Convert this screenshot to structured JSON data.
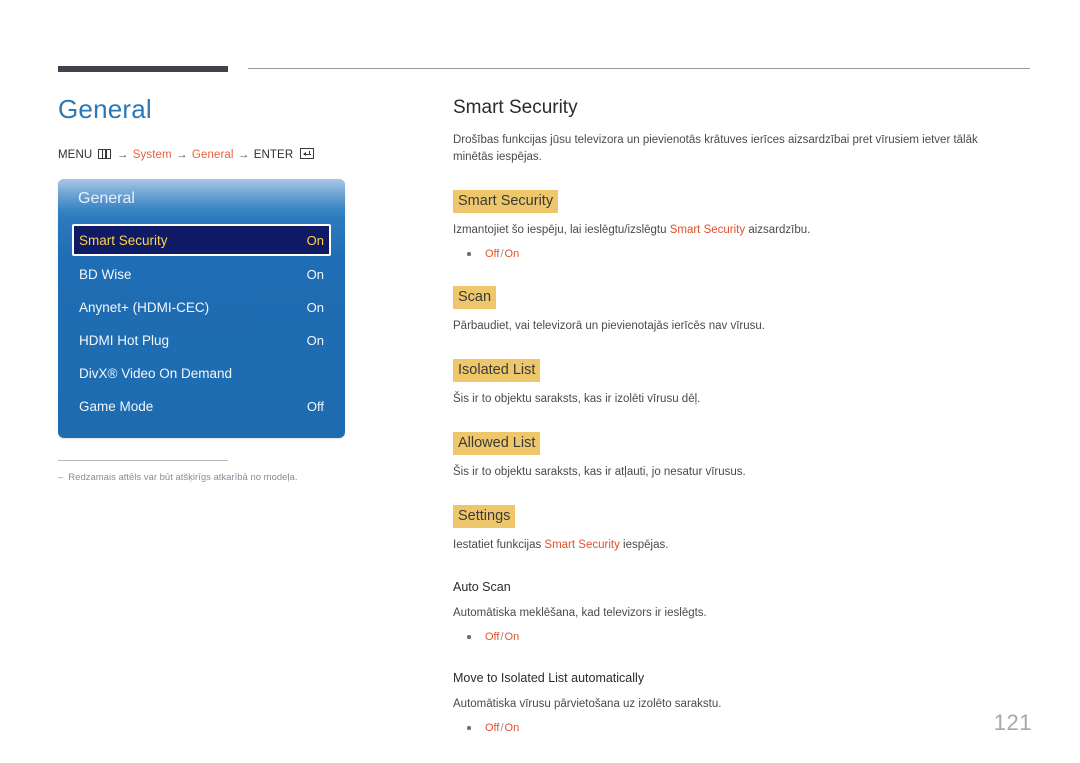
{
  "document": {
    "page_number": "121",
    "left": {
      "title": "General",
      "breadcrumb": {
        "menu_label": "MENU",
        "menu_icon": "menu-grid-icon",
        "arrow": "→",
        "items": [
          "System",
          "General"
        ],
        "enter_label": "ENTER",
        "enter_icon": "enter-return-icon"
      },
      "osd": {
        "header": "General",
        "rows": [
          {
            "label": "Smart Security",
            "value": "On",
            "selected": true
          },
          {
            "label": "BD Wise",
            "value": "On",
            "selected": false
          },
          {
            "label": "Anynet+ (HDMI-CEC)",
            "value": "On",
            "selected": false
          },
          {
            "label": "HDMI Hot Plug",
            "value": "On",
            "selected": false
          },
          {
            "label": "DivX® Video On Demand",
            "value": "",
            "selected": false
          },
          {
            "label": "Game Mode",
            "value": "Off",
            "selected": false
          }
        ]
      },
      "footnote": {
        "dash": "‒",
        "text": "Redzamais attēls var būt atšķirīgs atkarībā no modeļa."
      }
    },
    "right": {
      "section_title": "Smart Security",
      "intro": "Drošības funkcijas jūsu televizora un pievienotās krātuves ierīces aizsardzībai pret vīrusiem ietver tālāk minētās iespējas.",
      "blocks": [
        {
          "heading": "Smart Security",
          "heading_style": "highlight",
          "text_before": "Izmantojiet šo iespēju, lai ieslēgtu/izslēgtu ",
          "text_link": "Smart Security",
          "text_after": " aizsardzību.",
          "options": [
            "Off",
            "On"
          ]
        },
        {
          "heading": "Scan",
          "heading_style": "highlight",
          "text_before": "Pārbaudiet, vai televizorā un pievienotajās ierīcēs nav vīrusu.",
          "text_link": "",
          "text_after": "",
          "options": []
        },
        {
          "heading": "Isolated List",
          "heading_style": "highlight",
          "text_before": "Šis ir to objektu saraksts, kas ir izolēti vīrusu dēļ.",
          "text_link": "",
          "text_after": "",
          "options": []
        },
        {
          "heading": "Allowed List",
          "heading_style": "highlight",
          "text_before": "Šis ir to objektu saraksts, kas ir atļauti, jo nesatur vīrusus.",
          "text_link": "",
          "text_after": "",
          "options": []
        },
        {
          "heading": "Settings",
          "heading_style": "highlight",
          "text_before": "Iestatiet funkcijas ",
          "text_link": "Smart Security",
          "text_after": " iespējas.",
          "options": []
        },
        {
          "heading": "Auto Scan",
          "heading_style": "plain",
          "text_before": "Automātiska meklēšana, kad televizors ir ieslēgts.",
          "text_link": "",
          "text_after": "",
          "options": [
            "Off",
            "On"
          ]
        },
        {
          "heading": "Move to Isolated List automatically",
          "heading_style": "plain",
          "text_before": "Automātiska vīrusu pārvietošana uz izolēto sarakstu.",
          "text_link": "",
          "text_after": "",
          "options": [
            "Off",
            "On"
          ]
        }
      ]
    }
  },
  "colors": {
    "title_blue": "#2a79b8",
    "accent_orange": "#e0522c",
    "highlight_gold": "#eec76b",
    "osd_blue": "#1f6db4",
    "osd_selected_navy": "#0e1a63",
    "osd_selected_text": "#ffd24a",
    "rule_dark": "#45404e",
    "page_number_gray": "#a7a7ac"
  }
}
